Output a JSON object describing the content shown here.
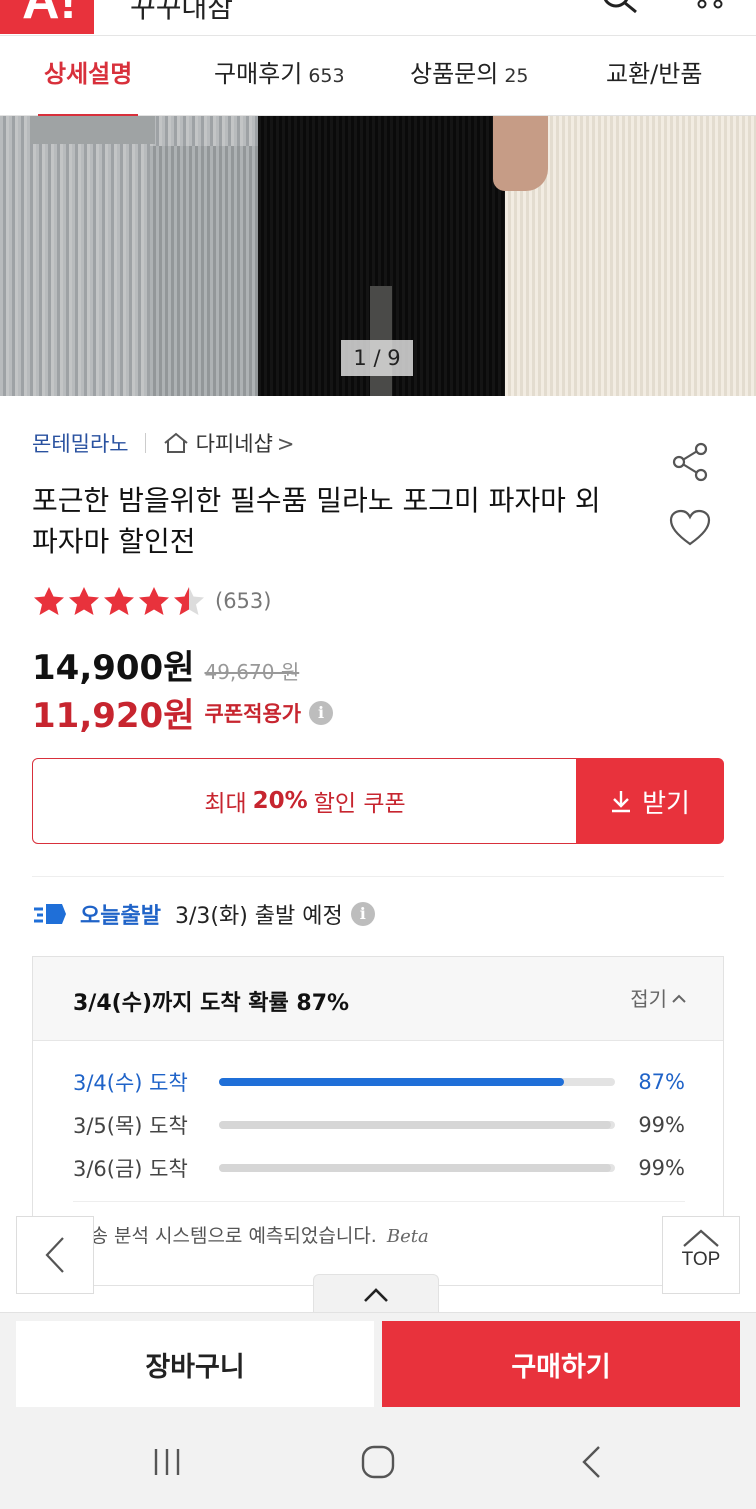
{
  "header": {
    "logo": "A!",
    "title": "꾸꾸대잠"
  },
  "tabs": [
    {
      "label": "상세설명",
      "count": ""
    },
    {
      "label": "구매후기",
      "count": "653"
    },
    {
      "label": "상품문의",
      "count": "25"
    },
    {
      "label": "교환/반품",
      "count": ""
    }
  ],
  "gallery": {
    "counter": "1 / 9"
  },
  "product": {
    "brand": "몬테밀라노",
    "shop": "다피네샵",
    "shop_arrow": ">",
    "title": "포근한 밤을위한 필수품 밀라노 포그미 파자마 외 파자마 할인전",
    "rating_value": 4.5,
    "rating_count": "(653)",
    "price": "14,900원",
    "original_price": "49,670 원",
    "coupon_price": "11,920원",
    "coupon_price_label": "쿠폰적용가"
  },
  "coupon": {
    "prefix": "최대",
    "rate": "20%",
    "suffix": "할인 쿠폰",
    "button_label": "받기"
  },
  "shipping": {
    "label": "오늘출발",
    "date": "3/3(화) 출발 예정"
  },
  "arrival": {
    "title": "3/4(수)까지 도착 확률 87%",
    "collapse_label": "접기",
    "rows": [
      {
        "label": "3/4(수) 도착",
        "percent": 87,
        "percent_text": "87%"
      },
      {
        "label": "3/5(목) 도착",
        "percent": 99,
        "percent_text": "99%"
      },
      {
        "label": "3/6(금) 도착",
        "percent": 99,
        "percent_text": "99%"
      }
    ],
    "note": "배송 분석 시스템으로 예측되었습니다.",
    "beta": "Beta"
  },
  "floating": {
    "top_label": "TOP"
  },
  "bottom_bar": {
    "cart_label": "장바구니",
    "buy_label": "구매하기"
  },
  "colors": {
    "accent": "#e8323c",
    "price_red": "#c7252f",
    "link_blue": "#1f63c8",
    "star": "#e8323c"
  }
}
